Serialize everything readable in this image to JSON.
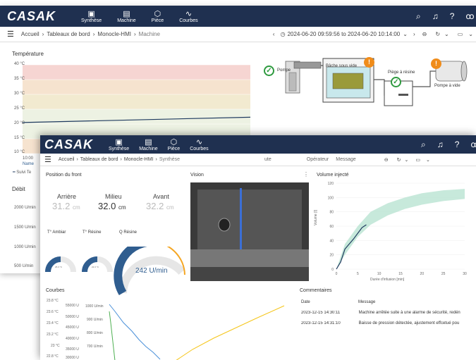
{
  "app": {
    "logo": "CASAK"
  },
  "nav": [
    {
      "label": "Synthèse",
      "icon": "▣"
    },
    {
      "label": "Machine",
      "icon": "▤"
    },
    {
      "label": "Pièce",
      "icon": "⬡"
    },
    {
      "label": "Courbes",
      "icon": "∿"
    }
  ],
  "back": {
    "breadcrumb": [
      "Accueil",
      "Tableaux de bord",
      "Monocle-HMI",
      "Machine"
    ],
    "time_range": "2024-06-20 09:59:56 to 2024-06-20 10:14:00",
    "temp_title": "Température",
    "temp_ticks": [
      "40 °C",
      "35 °C",
      "30 °C",
      "25 °C",
      "20 °C",
      "15 °C",
      "10 °C"
    ],
    "x_first_tick": "10:00",
    "legend_name": "Name",
    "legend_series": "Suivi Te",
    "debit_title": "Débit",
    "debit_ticks": [
      "2000 U/min",
      "1500 U/min",
      "1000 U/min",
      "500 U/min"
    ],
    "diagram": {
      "pompe": "Pompe",
      "bache": "Bâche sous vide",
      "piege": "Piège à résine",
      "pompe_vide": "Pompe à vide"
    }
  },
  "front": {
    "breadcrumb": [
      "Accueil",
      "Tableaux de bord",
      "Monocle-HMI",
      "Synthèse"
    ],
    "filter_hidden": "ute",
    "filter_operateur": "Opérateur",
    "filter_message": "Message",
    "position": {
      "title": "Position du front",
      "labels": [
        "Arrière",
        "Milieu",
        "Avant"
      ],
      "values": [
        "31.2",
        "32.0",
        "32.2"
      ],
      "unit": "cm"
    },
    "gauges": {
      "t_amb": "T° Ambiar",
      "t_res": "T° Résine",
      "q_res": "Q Résine",
      "q_value": "242 U/min",
      "tiny_values": [
        "25.3 °C",
        "22.3 °C"
      ]
    },
    "vision_title": "Vision",
    "volume": {
      "title": "Volume injecté",
      "ylabel": "Volume [l]",
      "xlabel": "Durée d'infusion [min]",
      "yticks": [
        "120",
        "100",
        "80",
        "60",
        "40",
        "20",
        "0"
      ],
      "xticks": [
        "0",
        "5",
        "10",
        "15",
        "20",
        "25",
        "30"
      ]
    },
    "courbes": {
      "title": "Courbes",
      "temp_ticks": [
        "23.8 °C",
        "23.6 °C",
        "23.4 °C",
        "23.2 °C",
        "23 °C",
        "22.8 °C"
      ],
      "u_ticks": [
        "55000 U",
        "50000 U",
        "45000 U",
        "40000 U",
        "35000 U",
        "30000 U"
      ],
      "rpm_ticks": [
        "1000 U/min",
        "900 U/min",
        "800 U/min",
        "700 U/min"
      ]
    },
    "comments": {
      "title": "Commentaires",
      "col_date": "Date",
      "col_message": "Message",
      "rows": [
        {
          "date": "2023-12-15 14:30:11",
          "message": "Machine arrêtée suite à une alarme de sécurité, redén"
        },
        {
          "date": "2023-12-15 14:31:10",
          "message": "Baisse de pression détectée, ajustement effcetué pou"
        }
      ]
    }
  },
  "colors": {
    "topbar": "#1f3050",
    "accent_orange": "#f5a623",
    "ok_green": "#2e9a3f",
    "gauge_blue": "#2f5d8f"
  },
  "chart_data": [
    {
      "type": "line",
      "title": "Température",
      "ylim": [
        10,
        40
      ],
      "bands": [
        {
          "from": 35,
          "to": 40,
          "color": "#f6d5d2"
        },
        {
          "from": 30,
          "to": 35,
          "color": "#f6e3cf"
        },
        {
          "from": 25,
          "to": 30,
          "color": "#f2ead0"
        },
        {
          "from": 15,
          "to": 25,
          "color": "#edf2e3"
        },
        {
          "from": 10,
          "to": 15,
          "color": "#f6e3cf"
        }
      ],
      "series": [
        {
          "name": "Suivi Te",
          "x": [
            0,
            1
          ],
          "y": [
            20.5,
            22.3
          ]
        }
      ]
    },
    {
      "type": "area",
      "title": "Volume injecté",
      "xlabel": "Durée d'infusion [min]",
      "ylabel": "Volume [l]",
      "xlim": [
        0,
        30
      ],
      "ylim": [
        0,
        120
      ],
      "band": {
        "x": [
          0,
          2,
          5,
          8,
          12,
          16,
          20,
          25,
          30
        ],
        "low": [
          0,
          20,
          45,
          62,
          75,
          84,
          90,
          95,
          98
        ],
        "high": [
          0,
          35,
          60,
          80,
          92,
          100,
          106,
          110,
          112
        ]
      },
      "series": [
        {
          "name": "",
          "x": [
            0,
            1,
            2,
            4,
            6,
            7
          ],
          "y": [
            0,
            10,
            28,
            42,
            58,
            62
          ]
        }
      ]
    }
  ]
}
